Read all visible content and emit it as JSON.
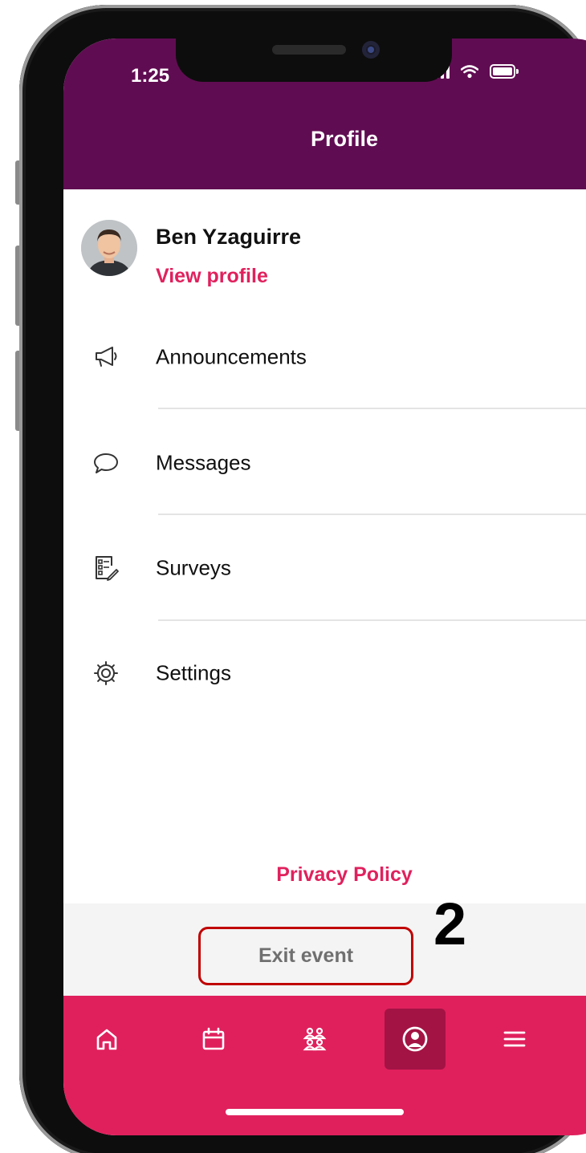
{
  "status_bar": {
    "time": "1:25"
  },
  "header": {
    "title": "Profile"
  },
  "profile": {
    "name": "Ben Yzaguirre",
    "view_profile_label": "View profile"
  },
  "menu": {
    "items": [
      {
        "label": "Announcements",
        "icon": "megaphone-icon"
      },
      {
        "label": "Messages",
        "icon": "speech-bubble-icon"
      },
      {
        "label": "Surveys",
        "icon": "survey-checklist-icon"
      },
      {
        "label": "Settings",
        "icon": "gear-icon"
      }
    ]
  },
  "footer": {
    "privacy_policy_label": "Privacy Policy",
    "exit_event_label": "Exit event"
  },
  "annotation": {
    "step_number": "2"
  },
  "bottom_nav": {
    "items": [
      {
        "icon": "home-icon"
      },
      {
        "icon": "calendar-icon"
      },
      {
        "icon": "people-icon"
      },
      {
        "icon": "profile-icon",
        "active": true
      },
      {
        "icon": "menu-icon"
      }
    ]
  },
  "colors": {
    "header_bg": "#600c52",
    "accent": "#e0215e",
    "nav_bg": "#e0205d",
    "nav_active": "#a31344",
    "annotation_border": "#c00000"
  }
}
